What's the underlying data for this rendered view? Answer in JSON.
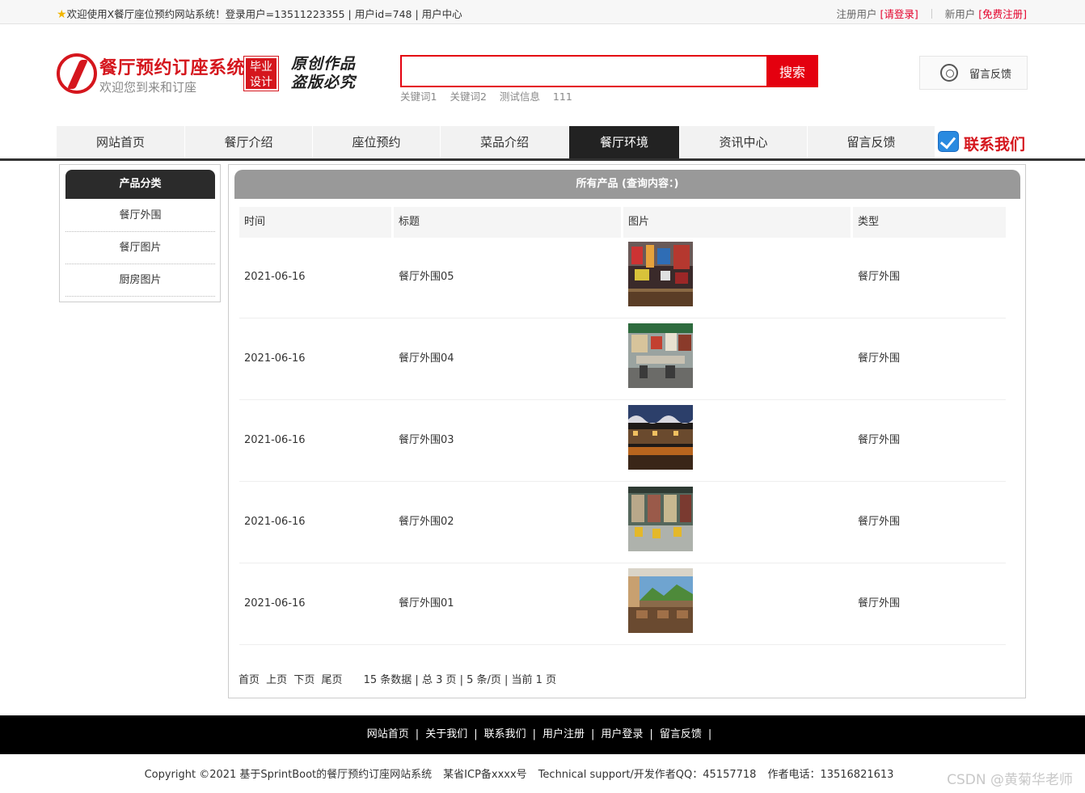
{
  "topbar": {
    "welcome": "欢迎使用X餐厅座位预约网站系统！登录用户=13511223355 | 用户id=748 | 用户中心",
    "registered_label": "注册用户",
    "login_link": "[请登录]",
    "new_user_label": "新用户",
    "register_link": "[免费注册]"
  },
  "header": {
    "title": "餐厅预约订座系统",
    "subtitle": "欢迎您到来和订座",
    "badge_line1": "毕业",
    "badge_line2": "设计",
    "slogan_line1": "原创作品",
    "slogan_line2": "盗版必究",
    "search_button": "搜索",
    "search_value": "",
    "hotwords": [
      "关键词1",
      "关键词2",
      "测试信息",
      "111"
    ],
    "feedback_label": "留言反馈"
  },
  "nav": {
    "items": [
      "网站首页",
      "餐厅介绍",
      "座位预约",
      "菜品介绍",
      "餐厅环境",
      "资讯中心",
      "留言反馈"
    ],
    "active_index": 4,
    "contact": "联系我们"
  },
  "sidebar": {
    "title": "产品分类",
    "categories": [
      "餐厅外围",
      "餐厅图片",
      "厨房图片"
    ]
  },
  "main": {
    "title": "所有产品 (查询内容：)",
    "columns": [
      "时间",
      "标题",
      "图片",
      "类型"
    ],
    "rows": [
      {
        "time": "2021-06-16",
        "title": "餐厅外围05",
        "type": "餐厅外围"
      },
      {
        "time": "2021-06-16",
        "title": "餐厅外围04",
        "type": "餐厅外围"
      },
      {
        "time": "2021-06-16",
        "title": "餐厅外围03",
        "type": "餐厅外围"
      },
      {
        "time": "2021-06-16",
        "title": "餐厅外围02",
        "type": "餐厅外围"
      },
      {
        "time": "2021-06-16",
        "title": "餐厅外围01",
        "type": "餐厅外围"
      }
    ],
    "pager": {
      "first": "首页",
      "prev": "上页",
      "next": "下页",
      "last": "尾页",
      "info": "15 条数据 | 总 3 页 | 5 条/页 | 当前 1 页"
    }
  },
  "footer": {
    "links": [
      "网站首页",
      "关于我们",
      "联系我们",
      "用户注册",
      "用户登录",
      "留言反馈"
    ],
    "separator": "|",
    "copyright": "Copyright ©2021 基于SprintBoot的餐厅预约订座网站系统",
    "icp": "某省ICP备xxxx号",
    "support": "Technical support/开发作者QQ：45157718",
    "phone": "作者电话：13516821613"
  },
  "watermark": "CSDN @黄菊华老师",
  "colors": {
    "brand_red": "#d5161d",
    "search_red": "#e4000f",
    "nav_active": "#222222",
    "footer_bg": "#000000"
  }
}
